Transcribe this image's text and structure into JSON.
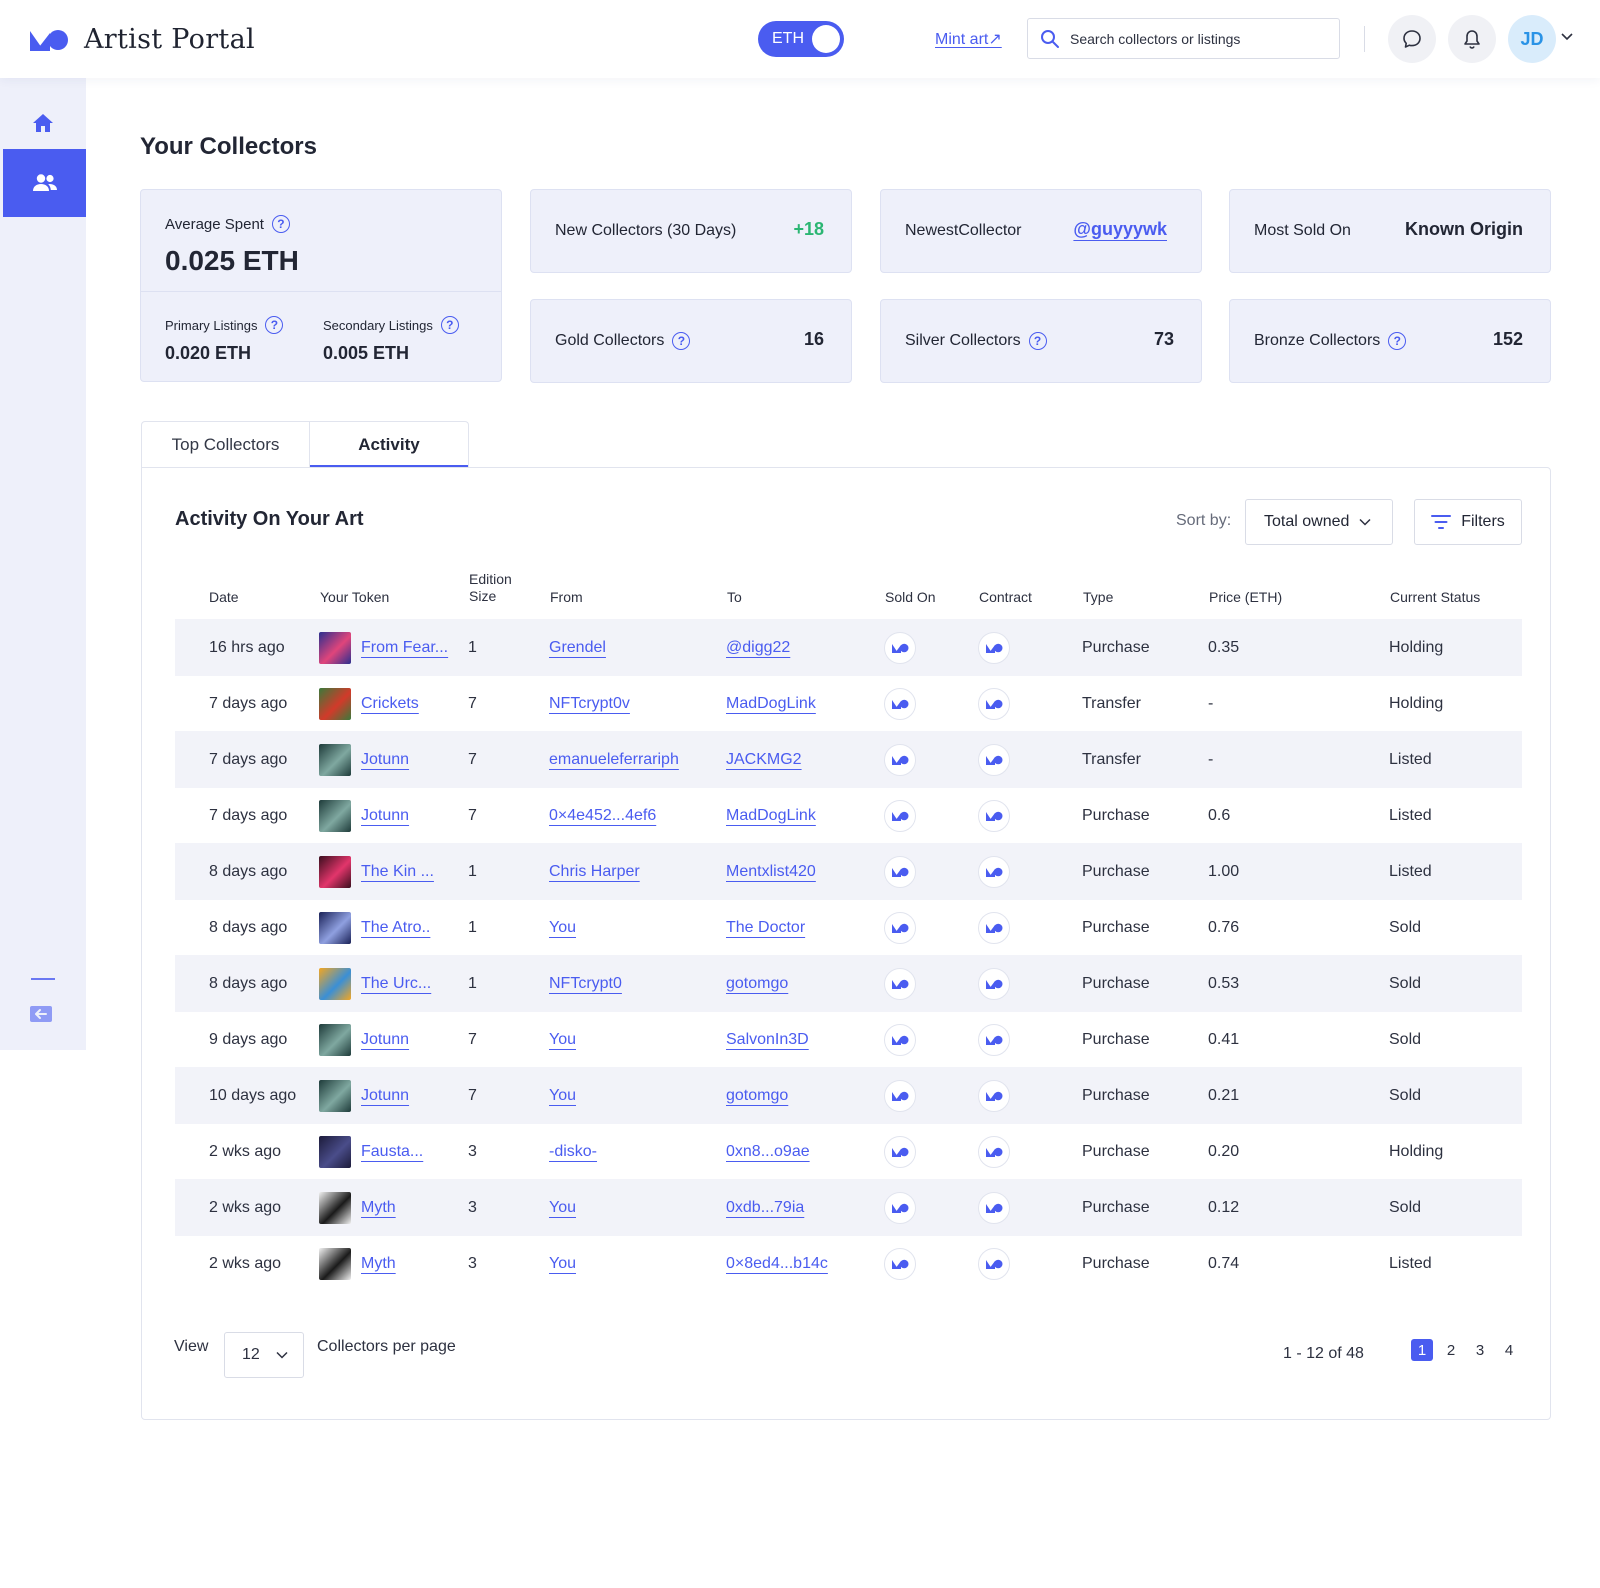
{
  "header": {
    "app_title": "Artist Portal",
    "currency_toggle": "ETH",
    "mint_link": "Mint art↗",
    "search_placeholder": "Search collectors or listings",
    "avatar_initials": "JD"
  },
  "page": {
    "title": "Your Collectors"
  },
  "stats": {
    "average_spent": {
      "label": "Average Spent",
      "value": "0.025 ETH"
    },
    "primary": {
      "label": "Primary Listings",
      "value": "0.020 ETH"
    },
    "secondary": {
      "label": "Secondary Listings",
      "value": "0.005 ETH"
    },
    "new_collectors": {
      "label": "New Collectors (30 Days)",
      "value": "+18"
    },
    "newest_collector": {
      "label": "NewestCollector",
      "value": "@guyyywk"
    },
    "most_sold_on": {
      "label": "Most Sold On",
      "value": "Known Origin"
    },
    "gold": {
      "label": "Gold Collectors",
      "value": "16"
    },
    "silver": {
      "label": "Silver Collectors",
      "value": "73"
    },
    "bronze": {
      "label": "Bronze Collectors",
      "value": "152"
    }
  },
  "tabs": [
    {
      "label": "Top Collectors"
    },
    {
      "label": "Activity"
    }
  ],
  "panel": {
    "title": "Activity On Your Art",
    "sort_label": "Sort by:",
    "sort_value": "Total owned",
    "filters_label": "Filters"
  },
  "table": {
    "columns": {
      "date": "Date",
      "token": "Your Token",
      "edition_1": "Edition",
      "edition_2": "Size",
      "from": "From",
      "to": "To",
      "sold_on": "Sold On",
      "contract": "Contract",
      "type": "Type",
      "price": "Price (ETH)",
      "status": "Current Status"
    },
    "rows": [
      {
        "date": "16 hrs ago",
        "token": "From Fear...",
        "thumb": [
          "#2b2f8f",
          "#e0457b"
        ],
        "edition": "1",
        "from": "Grendel",
        "to": "@digg22",
        "type": "Purchase",
        "price": "0.35",
        "status": "Holding"
      },
      {
        "date": "7 days ago",
        "token": "Crickets",
        "thumb": [
          "#3a7a3b",
          "#d23a2a"
        ],
        "edition": "7",
        "from": "NFTcrypt0v",
        "to": "MadDogLink",
        "type": "Transfer",
        "price": "-",
        "status": "Holding"
      },
      {
        "date": "7 days ago",
        "token": "Jotunn",
        "thumb": [
          "#1e3b3a",
          "#7fa8a0"
        ],
        "edition": "7",
        "from": "emanueleferrariph",
        "to": "JACKMG2",
        "type": "Transfer",
        "price": "-",
        "status": "Listed"
      },
      {
        "date": "7 days ago",
        "token": "Jotunn",
        "thumb": [
          "#1e3b3a",
          "#7fa8a0"
        ],
        "edition": "7",
        "from": "0×4e452...4ef6",
        "to": "MadDogLink",
        "type": "Purchase",
        "price": "0.6",
        "status": "Listed"
      },
      {
        "date": "8 days ago",
        "token": "The Kin ...",
        "thumb": [
          "#3a0e1e",
          "#e2356b"
        ],
        "edition": "1",
        "from": "Chris Harper",
        "to": "Mentxlist420",
        "type": "Purchase",
        "price": "1.00",
        "status": "Listed"
      },
      {
        "date": "8 days ago",
        "token": "The Atro..",
        "thumb": [
          "#1a2157",
          "#8fa0e0"
        ],
        "edition": "1",
        "from": "You",
        "to": "The Doctor",
        "type": "Purchase",
        "price": "0.76",
        "status": "Sold"
      },
      {
        "date": "8 days ago",
        "token": "The Urc...",
        "thumb": [
          "#f4a620",
          "#3a8fd6"
        ],
        "edition": "1",
        "from": "NFTcrypt0",
        "to": "gotomgo",
        "type": "Purchase",
        "price": "0.53",
        "status": "Sold"
      },
      {
        "date": "9 days ago",
        "token": "Jotunn",
        "thumb": [
          "#1e3b3a",
          "#7fa8a0"
        ],
        "edition": "7",
        "from": "You",
        "to": "SalvonIn3D",
        "type": "Purchase",
        "price": "0.41",
        "status": "Sold"
      },
      {
        "date": "10 days ago",
        "token": "Jotunn",
        "thumb": [
          "#1e3b3a",
          "#7fa8a0"
        ],
        "edition": "7",
        "from": "You",
        "to": "gotomgo",
        "type": "Purchase",
        "price": "0.21",
        "status": "Sold"
      },
      {
        "date": "2 wks ago",
        "token": "Fausta...",
        "thumb": [
          "#1c1b3a",
          "#4a4d8a"
        ],
        "edition": "3",
        "from": "-disko-",
        "to": "0xn8...o9ae",
        "type": "Purchase",
        "price": "0.20",
        "status": "Holding"
      },
      {
        "date": "2 wks ago",
        "token": "Myth",
        "thumb": [
          "#f2f2f2",
          "#1a1a1a"
        ],
        "edition": "3",
        "from": "You",
        "to": "0xdb...79ia",
        "type": "Purchase",
        "price": "0.12",
        "status": "Sold"
      },
      {
        "date": "2 wks ago",
        "token": "Myth",
        "thumb": [
          "#f2f2f2",
          "#1a1a1a"
        ],
        "edition": "3",
        "from": "You",
        "to": "0×8ed4...b14c",
        "type": "Purchase",
        "price": "0.74",
        "status": "Listed"
      }
    ]
  },
  "footer": {
    "view_label": "View",
    "per_page_value": "12",
    "per_page_label": "Collectors per page",
    "range": "1 - 12 of 48",
    "pages": [
      "1",
      "2",
      "3",
      "4"
    ],
    "active_page": "1"
  },
  "colors": {
    "accent": "#4a5cf0",
    "card_bg": "#eef0fa",
    "positive": "#2bb673",
    "row_shade": "#f2f3f9"
  },
  "icons": [
    "logo-icon",
    "search-icon",
    "chat-icon",
    "bell-icon",
    "chevron-down-icon",
    "home-icon",
    "users-icon",
    "exit-icon",
    "help-icon",
    "filter-icon",
    "platform-logo-icon"
  ]
}
